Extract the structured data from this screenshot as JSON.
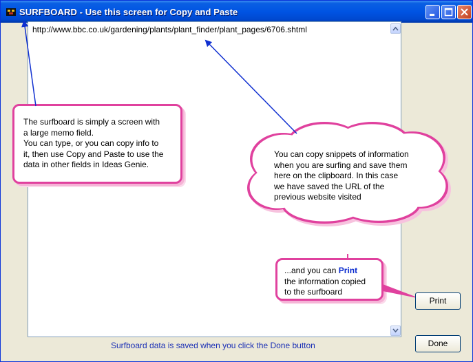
{
  "window": {
    "title": "SURFBOARD - Use this screen for Copy and Paste",
    "icon": "surfboard-app-icon",
    "controls": [
      "minimize-icon",
      "maximize-icon",
      "close-icon"
    ]
  },
  "memo": {
    "value": "http://www.bbc.co.uk/gardening/plants/plant_finder/plant_pages/6706.shtml"
  },
  "callouts": {
    "memo_info": {
      "lines": [
        "The surfboard is simply a screen with",
        "a large memo field.",
        "You can type, or you can copy info to",
        "it, then use Copy and Paste to use the",
        "data in other fields in Ideas Genie."
      ]
    },
    "clipboard_info": {
      "lines": [
        "You can copy snippets of information",
        "when you are surfing and save them",
        "here on the clipboard. In this case",
        "we have saved the URL of the",
        "previous website visited"
      ]
    },
    "print_info": {
      "prefix": "...and you can ",
      "highlight": "Print",
      "line2": "the information copied",
      "line3": "to the surfboard"
    }
  },
  "buttons": {
    "print": "Print",
    "done": "Done"
  },
  "footer_note": "Surfboard data is saved when you click the Done button",
  "colors": {
    "titlebar": "#0054e3",
    "callout_border": "#e0419e",
    "arrow": "#1030d0",
    "footer_text": "#1a2fb5"
  }
}
